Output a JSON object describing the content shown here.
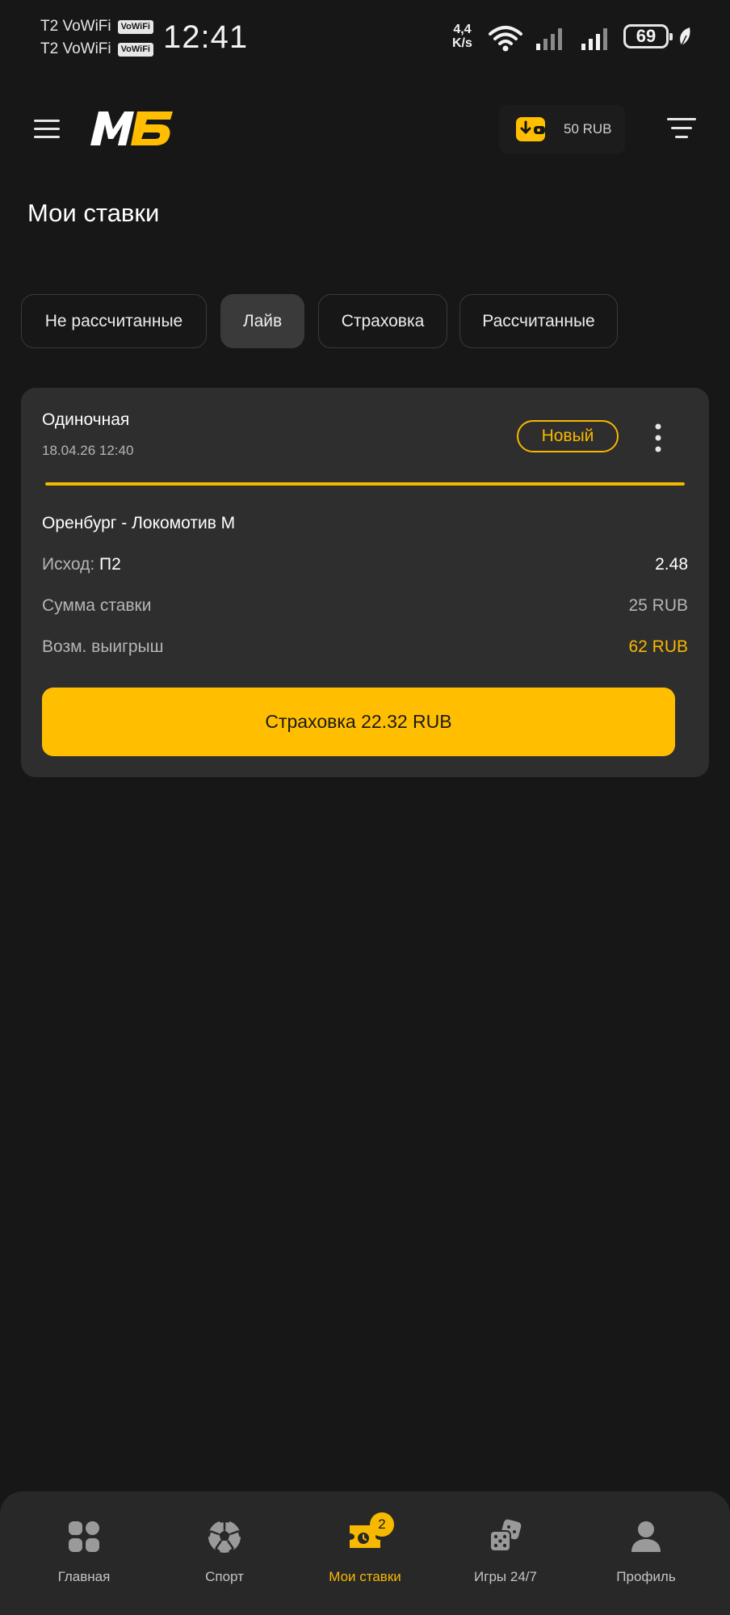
{
  "status_bar": {
    "carrier_1": "T2 VoWiFi",
    "carrier_2": "T2 VoWiFi",
    "vowifi_badge": "VoWiFi",
    "time": "12:41",
    "net_speed_value": "4,4",
    "net_speed_unit": "K/s",
    "battery": "69"
  },
  "header": {
    "logo_text": "МБ",
    "wallet_balance": "50 RUB"
  },
  "page_title": "Мои ставки",
  "tabs": [
    {
      "label": "Не рассчитанные",
      "active": false
    },
    {
      "label": "Лайв",
      "active": true
    },
    {
      "label": "Страховка",
      "active": false
    },
    {
      "label": "Рассчитанные",
      "active": false
    }
  ],
  "bet": {
    "type": "Одиночная",
    "date": "18.04.26 12:40",
    "status": "Новый",
    "match": "Оренбург - Локомотив М",
    "outcome_label": "Исход:",
    "outcome_value": "П2",
    "odds": "2.48",
    "stake_label": "Сумма ставки",
    "stake_value": "25 RUB",
    "win_label": "Возм. выигрыш",
    "win_value": "62 RUB",
    "progress": 1.0,
    "insurance_button": "Страховка 22.32 RUB"
  },
  "bottom_nav": {
    "items": [
      {
        "label": "Главная",
        "icon": "home-grid-icon"
      },
      {
        "label": "Спорт",
        "icon": "soccer-ball-icon"
      },
      {
        "label": "Мои ставки",
        "icon": "bet-ticket-icon",
        "badge": "2",
        "active": true
      },
      {
        "label": "Игры 24/7",
        "icon": "dice-icon"
      },
      {
        "label": "Профиль",
        "icon": "profile-icon"
      }
    ]
  },
  "colors": {
    "accent": "#f7b800",
    "button": "#ffbe00",
    "background": "#171717",
    "card": "#2e2e2e"
  }
}
